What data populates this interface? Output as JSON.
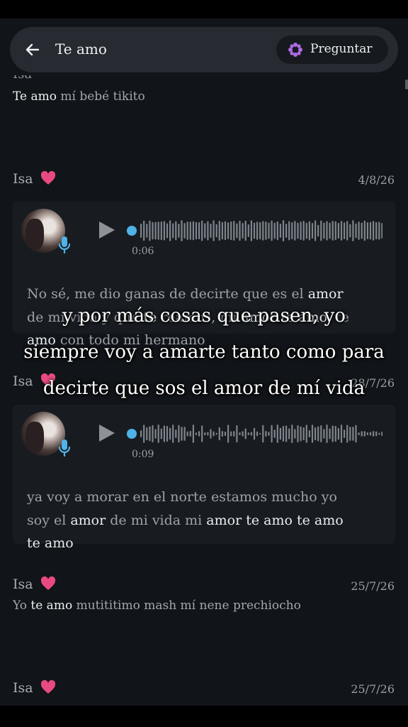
{
  "search": {
    "query": "Te amo",
    "ask_label": "Preguntar"
  },
  "messages": [
    {
      "sender": "Isa",
      "date": "",
      "text_parts": [
        {
          "t": "Te amo",
          "hl": true
        },
        {
          "t": " mí bebé tikito",
          "hl": false
        }
      ]
    },
    {
      "sender": "Isa",
      "date": "4/8/26",
      "voice": {
        "duration": "0:06",
        "transcript_lines": [
          [
            {
              "t": "No sé, me dio ganas de decirte que es el ",
              "hl": false
            },
            {
              "t": "amor",
              "hl": true
            }
          ],
          [
            {
              "t": "de mi vida y que ",
              "hl": false
            },
            {
              "t": "te",
              "hl": true
            },
            {
              "t": " reamos, mi ",
              "hl": false
            },
            {
              "t": "amor te amo",
              "hl": true
            },
            {
              "t": ", te",
              "hl": false
            }
          ],
          [
            {
              "t": "amo",
              "hl": true
            },
            {
              "t": " con todo mi hermano",
              "hl": false
            }
          ]
        ]
      }
    },
    {
      "sender": "Isa",
      "date": "28/7/26",
      "voice": {
        "duration": "0:09",
        "transcript_lines": [
          [
            {
              "t": "ya voy a morar en el norte estamos mucho yo",
              "hl": false
            }
          ],
          [
            {
              "t": "soy el ",
              "hl": false
            },
            {
              "t": "amor",
              "hl": true
            },
            {
              "t": " de mi vida mi ",
              "hl": false
            },
            {
              "t": "amor te amo te amo",
              "hl": true
            }
          ],
          [
            {
              "t": "te amo",
              "hl": true
            }
          ]
        ]
      }
    },
    {
      "sender": "Isa",
      "date": "25/7/26",
      "text_parts": [
        {
          "t": "Yo ",
          "hl": false
        },
        {
          "t": "te amo",
          "hl": true
        },
        {
          "t": " mutititimo mash mí nene prechiocho",
          "hl": false
        }
      ]
    },
    {
      "sender": "Isa",
      "date": "25/7/26"
    }
  ],
  "caption_lines": [
    "y por más cosas que pasen, yo",
    "siempre voy a amarte tanto como para",
    "decirte que sos el amor de mí vida"
  ],
  "colors": {
    "background": "#111418",
    "card": "#181c21",
    "accent_blue": "#4fb3e8",
    "heart": "#e84a7f"
  }
}
